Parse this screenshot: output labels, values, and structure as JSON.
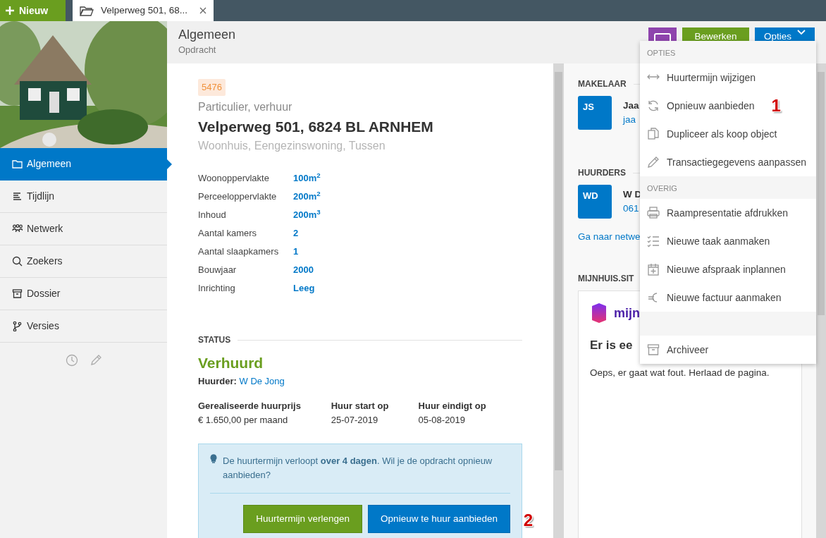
{
  "topbar": {
    "new_button": "Nieuw",
    "tab": {
      "title": "Velperweg 501, 68...",
      "selected": true
    }
  },
  "sidebar": {
    "items": [
      {
        "label": "Algemeen",
        "selected": true
      },
      {
        "label": "Tijdlijn",
        "selected": false
      },
      {
        "label": "Netwerk",
        "selected": false
      },
      {
        "label": "Zoekers",
        "selected": false
      },
      {
        "label": "Dossier",
        "selected": false
      },
      {
        "label": "Versies",
        "selected": false
      }
    ]
  },
  "header": {
    "title": "Algemeen",
    "subtitle": "Opdracht",
    "buttons": [
      {
        "kind": "icon"
      },
      {
        "kind": "text",
        "label": "Bewerken"
      },
      {
        "kind": "dropdown",
        "label": "Opties"
      }
    ]
  },
  "object": {
    "id": "5476",
    "category": "Particulier, verhuur",
    "address": "Velperweg 501, 6824 BL ARNHEM",
    "type": "Woonhuis, Eengezinswoning, Tussen",
    "properties": [
      {
        "label": "Woonoppervlakte",
        "value": "100m$^{2}$"
      },
      {
        "label": "Perceeloppervlakte",
        "value": "200m$^{2}$"
      },
      {
        "label": "Inhoud",
        "value": "200m$^{3}$"
      },
      {
        "label": "Aantal kamers",
        "value": "2"
      },
      {
        "label": "Aantal slaapkamers",
        "value": "1"
      },
      {
        "label": "Bouwjaar",
        "value": "2000"
      },
      {
        "label": "Inrichting",
        "value": "Leeg"
      }
    ]
  },
  "status": {
    "heading": "STATUS",
    "value": "Verhuurd",
    "tenant_label": "Huurder:",
    "tenant": "W De Jong",
    "facts": [
      {
        "label": "Gerealiseerde huurprijs",
        "value": "€ 1.650,00 per maand"
      },
      {
        "label": "Huur start op",
        "value": "25-07-2019"
      },
      {
        "label": "Huur eindigt op",
        "value": "05-08-2019"
      }
    ],
    "notice": {
      "text": "De huurtermijn verloopt **over 4 dagen**. Wil je de opdracht opnieuw aanbieden?",
      "buttons": [
        {
          "label": "Huurtermijn verlengen",
          "kind": "secondary"
        },
        {
          "label": "Opnieuw te huur aanbieden",
          "kind": "primary",
          "callout": "2"
        }
      ]
    }
  },
  "right_panel": {
    "makelaar": {
      "heading": "MAKELAAR",
      "initials": "JS",
      "name": "Jaa",
      "detail": "jaa"
    },
    "huurders": {
      "heading": "HUURDERS",
      "initials": "WD",
      "name": "W D",
      "detail": "061",
      "link": "Ga naar netwe"
    },
    "mijnhuis": {
      "heading": "MIJNHUIS.SIT",
      "logo_text": "mijn",
      "title": "Er is ee",
      "message": "Oeps, er gaat wat fout. Herlaad de pagina."
    }
  },
  "menu": {
    "sections": [
      {
        "title": "OPTIES",
        "items": [
          {
            "label": "Huurtermijn wijzigen"
          },
          {
            "label": "Opnieuw aanbieden",
            "callout": "1"
          },
          {
            "label": "Dupliceer als koop object"
          },
          {
            "label": "Transactiegegevens aanpassen"
          }
        ]
      },
      {
        "title": "OVERIG",
        "items": [
          {
            "label": "Raampresentatie afdrukken"
          },
          {
            "label": "Nieuwe taak aanmaken"
          },
          {
            "label": "Nieuwe afspraak inplannen"
          },
          {
            "label": "Nieuwe factuur aanmaken"
          }
        ]
      },
      {
        "items": [
          {
            "label": "Archiveer"
          }
        ]
      }
    ]
  }
}
